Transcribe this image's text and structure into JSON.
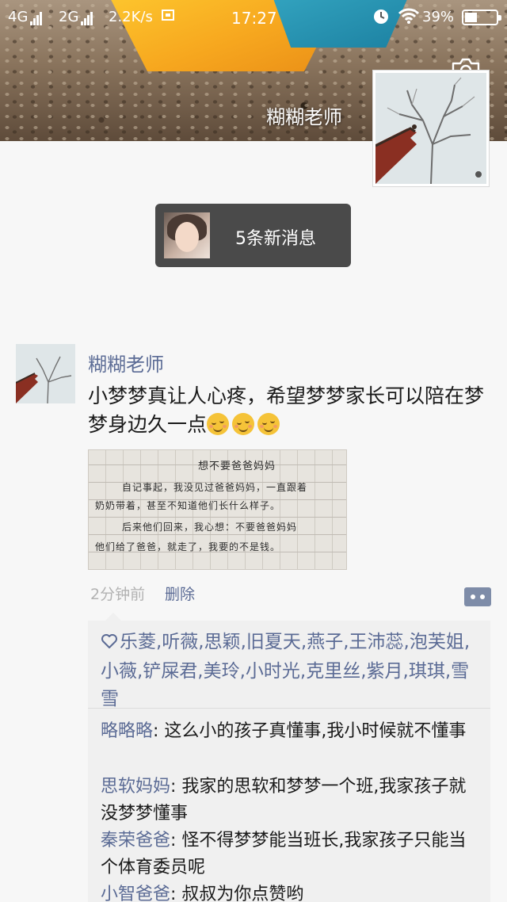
{
  "status_bar": {
    "network1": "4G",
    "network2": "2G",
    "speed": "2.2K/s",
    "time": "17:27",
    "battery": "39%",
    "battery_level": 0.39
  },
  "cover": {
    "name": "糊糊老师"
  },
  "new_messages": {
    "label": "5条新消息"
  },
  "post": {
    "author": "糊糊老师",
    "text": "小梦梦真让人心疼，希望梦梦家长可以陪在梦梦身边久一点",
    "emojis": [
      "relieved-face-icon",
      "relieved-face-icon",
      "relieved-face-icon"
    ],
    "image": {
      "title": "想不要爸爸妈妈",
      "lines": [
        "自记事起，我没见过爸爸妈妈，一直跟着",
        "奶奶带着，甚至不知道他们长什么样子。",
        "后来他们回来，我心想：不要爸爸妈妈",
        "他们给了爸爸，就走了，我要的不是钱。"
      ]
    },
    "time": "2分钟前",
    "delete_label": "删除"
  },
  "likes": {
    "names": "乐菱,听薇,思颖,旧夏天,燕子,王沛蕊,泡芙姐,小薇,铲屎君,美玲,小时光,克里丝,紫月,琪琪,雪雪"
  },
  "comments": [
    {
      "name": "略略略",
      "text": ": 这么小的孩子真懂事,我小时候就不懂事"
    },
    {
      "name": "思软妈妈",
      "text": ": 我家的思软和梦梦一个班,我家孩子就没梦梦懂事"
    },
    {
      "name": "秦荣爸爸",
      "text": ": 怪不得梦梦能当班长,我家孩子只能当个体育委员呢"
    },
    {
      "name": "小智爸爸",
      "text": ": 叔叔为你点赞哟"
    }
  ],
  "colors": {
    "link": "#5b6b95",
    "notice_bg": "#4a4a4a",
    "box_bg": "#f0f0f0"
  }
}
